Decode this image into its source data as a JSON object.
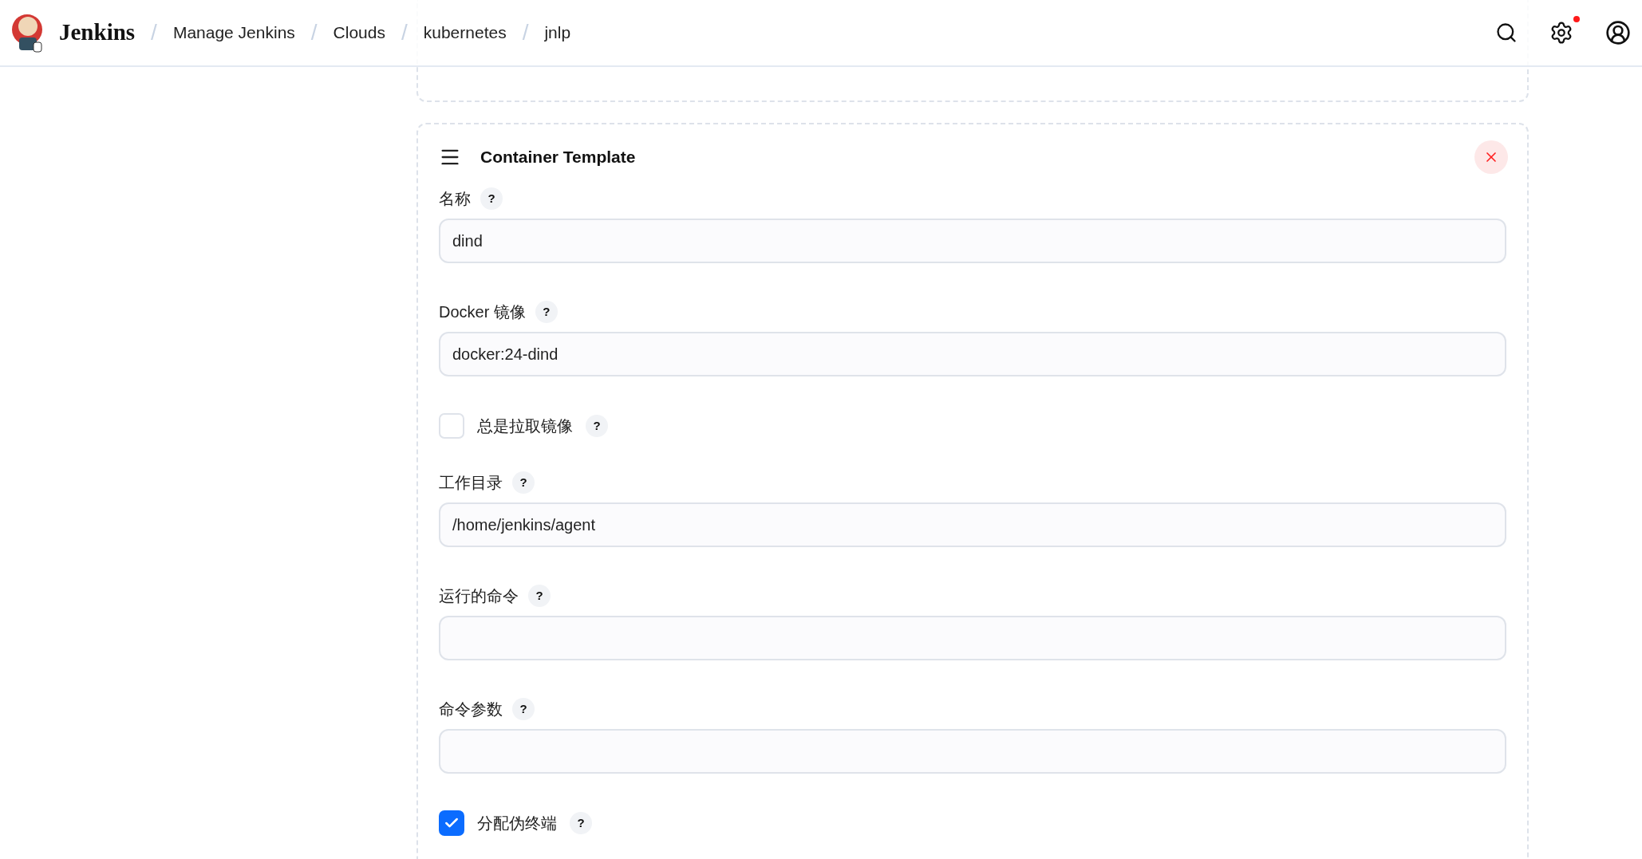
{
  "header": {
    "brand": "Jenkins",
    "separator": "/",
    "breadcrumbs": [
      "Manage Jenkins",
      "Clouds",
      "kubernetes",
      "jnlp"
    ],
    "notification": true
  },
  "container_template": {
    "title": "Container Template",
    "fields": [
      {
        "kind": "text",
        "label": "名称",
        "help": "?",
        "value": "dind"
      },
      {
        "kind": "text",
        "label": "Docker 镜像",
        "help": "?",
        "value": "docker:24-dind"
      },
      {
        "kind": "checkbox",
        "label": "总是拉取镜像",
        "help": "?",
        "checked": false
      },
      {
        "kind": "text",
        "label": "工作目录",
        "help": "?",
        "value": "/home/jenkins/agent"
      },
      {
        "kind": "text",
        "label": "运行的命令",
        "help": "?"
      },
      {
        "kind": "text",
        "label": "命令参数",
        "help": "?"
      },
      {
        "kind": "checkbox",
        "label": "分配伪终端",
        "help": "?",
        "checked": true
      }
    ]
  }
}
